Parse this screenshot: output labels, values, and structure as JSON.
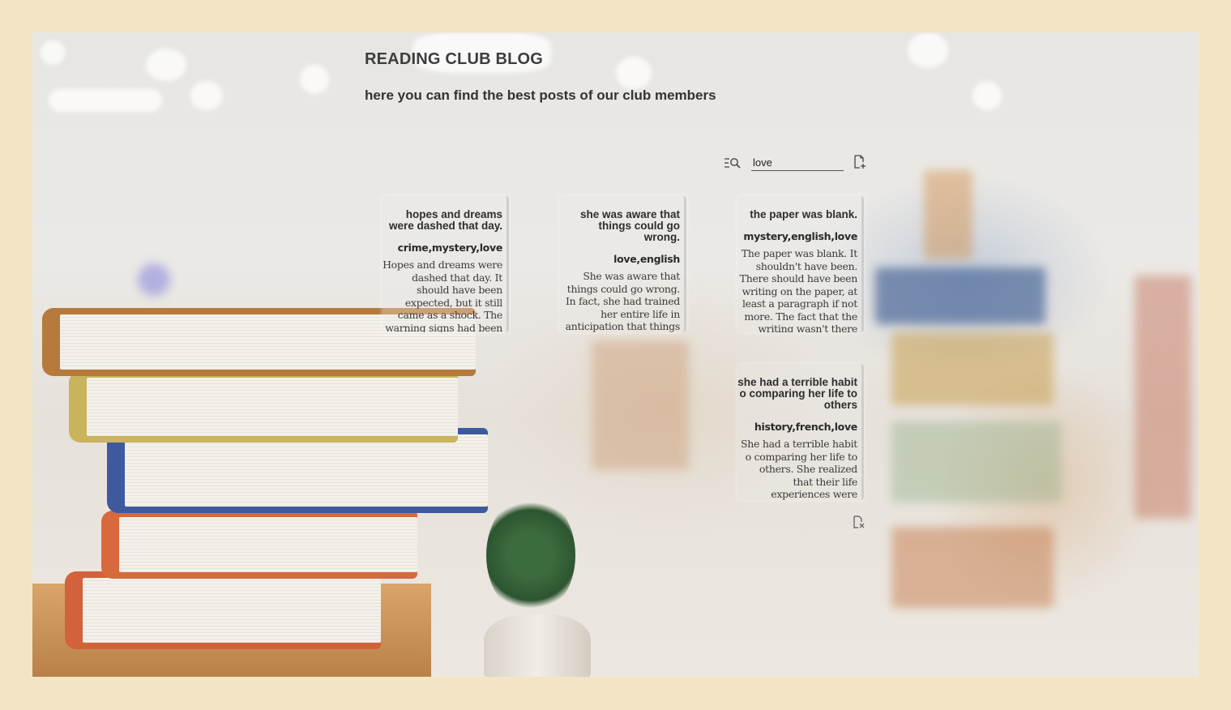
{
  "header": {
    "title": "READING CLUB BLOG",
    "subtitle": "here you can find the best posts of our club members"
  },
  "search": {
    "value": "love",
    "icon": "search-filter-icon",
    "add_icon": "new-post-icon"
  },
  "posts": [
    {
      "title": "hopes and dreams were dashed that day.",
      "tags": "crime,mystery,love",
      "body": "Hopes and dreams were dashed that day. It should have been expected, but it still came as a shock. The warning signs had been"
    },
    {
      "title": "she was aware that things could go wrong.",
      "tags": "love,english",
      "body": "She was aware that things could go wrong. In fact, she had trained her entire life in anticipation that things would go wrong one day."
    },
    {
      "title": "the paper was blank.",
      "tags": "mystery,english,love",
      "body": "The paper was blank. It shouldn't have been. There should have been writing on the paper, at least a paragraph if not more. The fact that the writing wasn't there"
    },
    {
      "title": "she had a terrible habit o comparing her life to others",
      "tags": "history,french,love",
      "body": "She had a terrible habit o comparing her life to others. She realized that their life experiences were"
    }
  ],
  "footer_icon": "delete-post-icon",
  "colors": {
    "page_background": "#f4e4c6",
    "text_dark": "#3d3d3d"
  }
}
